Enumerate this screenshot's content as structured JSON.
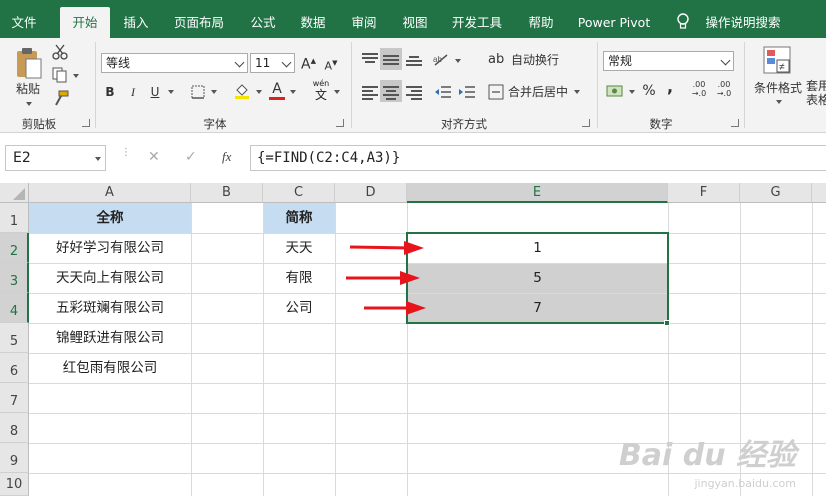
{
  "tabs": [
    {
      "label": "文件",
      "active": false
    },
    {
      "label": "开始",
      "active": true
    },
    {
      "label": "插入",
      "active": false
    },
    {
      "label": "页面布局",
      "active": false
    },
    {
      "label": "公式",
      "active": false
    },
    {
      "label": "数据",
      "active": false
    },
    {
      "label": "审阅",
      "active": false
    },
    {
      "label": "视图",
      "active": false
    },
    {
      "label": "开发工具",
      "active": false
    },
    {
      "label": "帮助",
      "active": false
    },
    {
      "label": "Power Pivot",
      "active": false
    }
  ],
  "tell_me": "操作说明搜索",
  "ribbon": {
    "clipboard": {
      "group_label": "剪贴板",
      "paste_label": "粘贴"
    },
    "font": {
      "group_label": "字体",
      "font_name": "等线",
      "font_size": "11",
      "bold": "B",
      "italic": "I",
      "underline": "U",
      "font_color_letter": "A",
      "wen_label": "wén",
      "wen_char": "文",
      "grow_letter": "A",
      "shrink_letter": "A",
      "font_color_hex": "#e02020",
      "fill_color_hex": "#f5e400"
    },
    "alignment": {
      "group_label": "对齐方式",
      "wrap_text": "自动换行",
      "merge_center": "合并后居中"
    },
    "number": {
      "group_label": "数字",
      "format": "常规",
      "percent": "%",
      "comma": ",",
      "inc_decimal": ".00\n→.0",
      "dec_decimal": ".00\n→.0"
    },
    "styles": {
      "conditional_format": "条件格式",
      "table_format": "套用\n表格格"
    }
  },
  "formula_bar": {
    "name_box": "E2",
    "cancel": "✕",
    "enter": "✓",
    "fx": "fx",
    "formula": "{=FIND(C2:C4,A3)}"
  },
  "sheet": {
    "columns": [
      "A",
      "B",
      "C",
      "D",
      "E",
      "F",
      "G"
    ],
    "rows": [
      "1",
      "2",
      "3",
      "4",
      "5",
      "6",
      "7",
      "8",
      "9",
      "10"
    ],
    "cells": {
      "A1": "全称",
      "A2": "好好学习有限公司",
      "A3": "天天向上有限公司",
      "A4": "五彩斑斓有限公司",
      "A5": "锦鲤跃进有限公司",
      "A6": "红包雨有限公司",
      "C1": "简称",
      "C2": "天天",
      "C3": "有限",
      "C4": "公司",
      "E2": "1",
      "E3": "5",
      "E4": "7"
    },
    "selected_range": "E2:E4",
    "accent": "#217346",
    "header_fill": "#c5dcf1",
    "arrow_color": "#e8141b"
  },
  "watermark": {
    "logo": "Bai du 经验",
    "url": "jingyan.baidu.com"
  }
}
